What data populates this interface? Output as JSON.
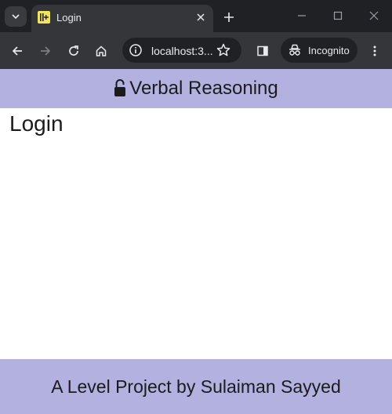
{
  "browser": {
    "tab": {
      "title": "Login",
      "favicon": "project-favicon-icon"
    },
    "omnibox": {
      "url": "localhost:3...",
      "info_icon": "info-icon",
      "star_icon": "star-icon"
    },
    "incognito_label": "Incognito",
    "icons": {
      "tab_search": "chevron-down-icon",
      "new_tab": "plus-icon",
      "minimize": "minimize-icon",
      "maximize": "maximize-icon",
      "close": "close-icon",
      "back": "back-arrow-icon",
      "forward": "forward-arrow-icon",
      "reload": "reload-icon",
      "home": "home-icon",
      "side_panel": "side-panel-icon",
      "menu": "kebab-menu-icon"
    }
  },
  "page": {
    "header": {
      "icon": "lock-icon",
      "title": "Verbal Reasoning"
    },
    "heading": "Login",
    "footer": "A Level Project by Sulaiman Sayyed"
  },
  "colors": {
    "chrome_dark": "#202124",
    "chrome_toolbar": "#35363a",
    "header_footer_bg": "#b3b1e0",
    "text": "#1b1b1b"
  }
}
